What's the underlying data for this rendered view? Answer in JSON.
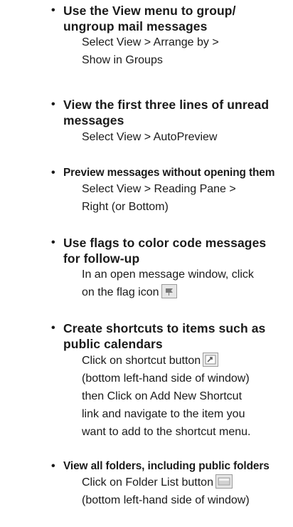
{
  "tips": [
    {
      "title_lines": [
        "Use the View menu to group/",
        "ungroup mail messages"
      ],
      "desc_lines": [
        "Select View > Arrange by >",
        "Show in Groups"
      ]
    },
    {
      "title_lines": [
        "View the first three lines of unread",
        "messages"
      ],
      "desc_lines": [
        "Select View > AutoPreview"
      ]
    },
    {
      "title_lines": [
        "Preview messages without opening them"
      ],
      "desc_lines": [
        "Select View > Reading Pane >",
        "Right (or Bottom)"
      ]
    },
    {
      "title_lines": [
        "Use flags to color code messages",
        "for follow-up"
      ],
      "desc_lines": [
        "In an open message window, click",
        "on the flag icon"
      ],
      "icon": "flag-icon"
    },
    {
      "title_lines": [
        "Create shortcuts to items such as",
        "public calendars"
      ],
      "desc_lines": [
        "Click on shortcut button",
        "(bottom left-hand side of window)",
        "then Click on Add New Shortcut",
        "link and navigate to the item you",
        "want to add to the shortcut menu."
      ],
      "icon": "shortcut-icon"
    },
    {
      "title_lines": [
        "View all folders, including public folders"
      ],
      "desc_lines": [
        "Click on Folder List button",
        "(bottom left-hand side of window)"
      ],
      "icon": "folder-list-icon"
    }
  ],
  "bullet_char": "•"
}
